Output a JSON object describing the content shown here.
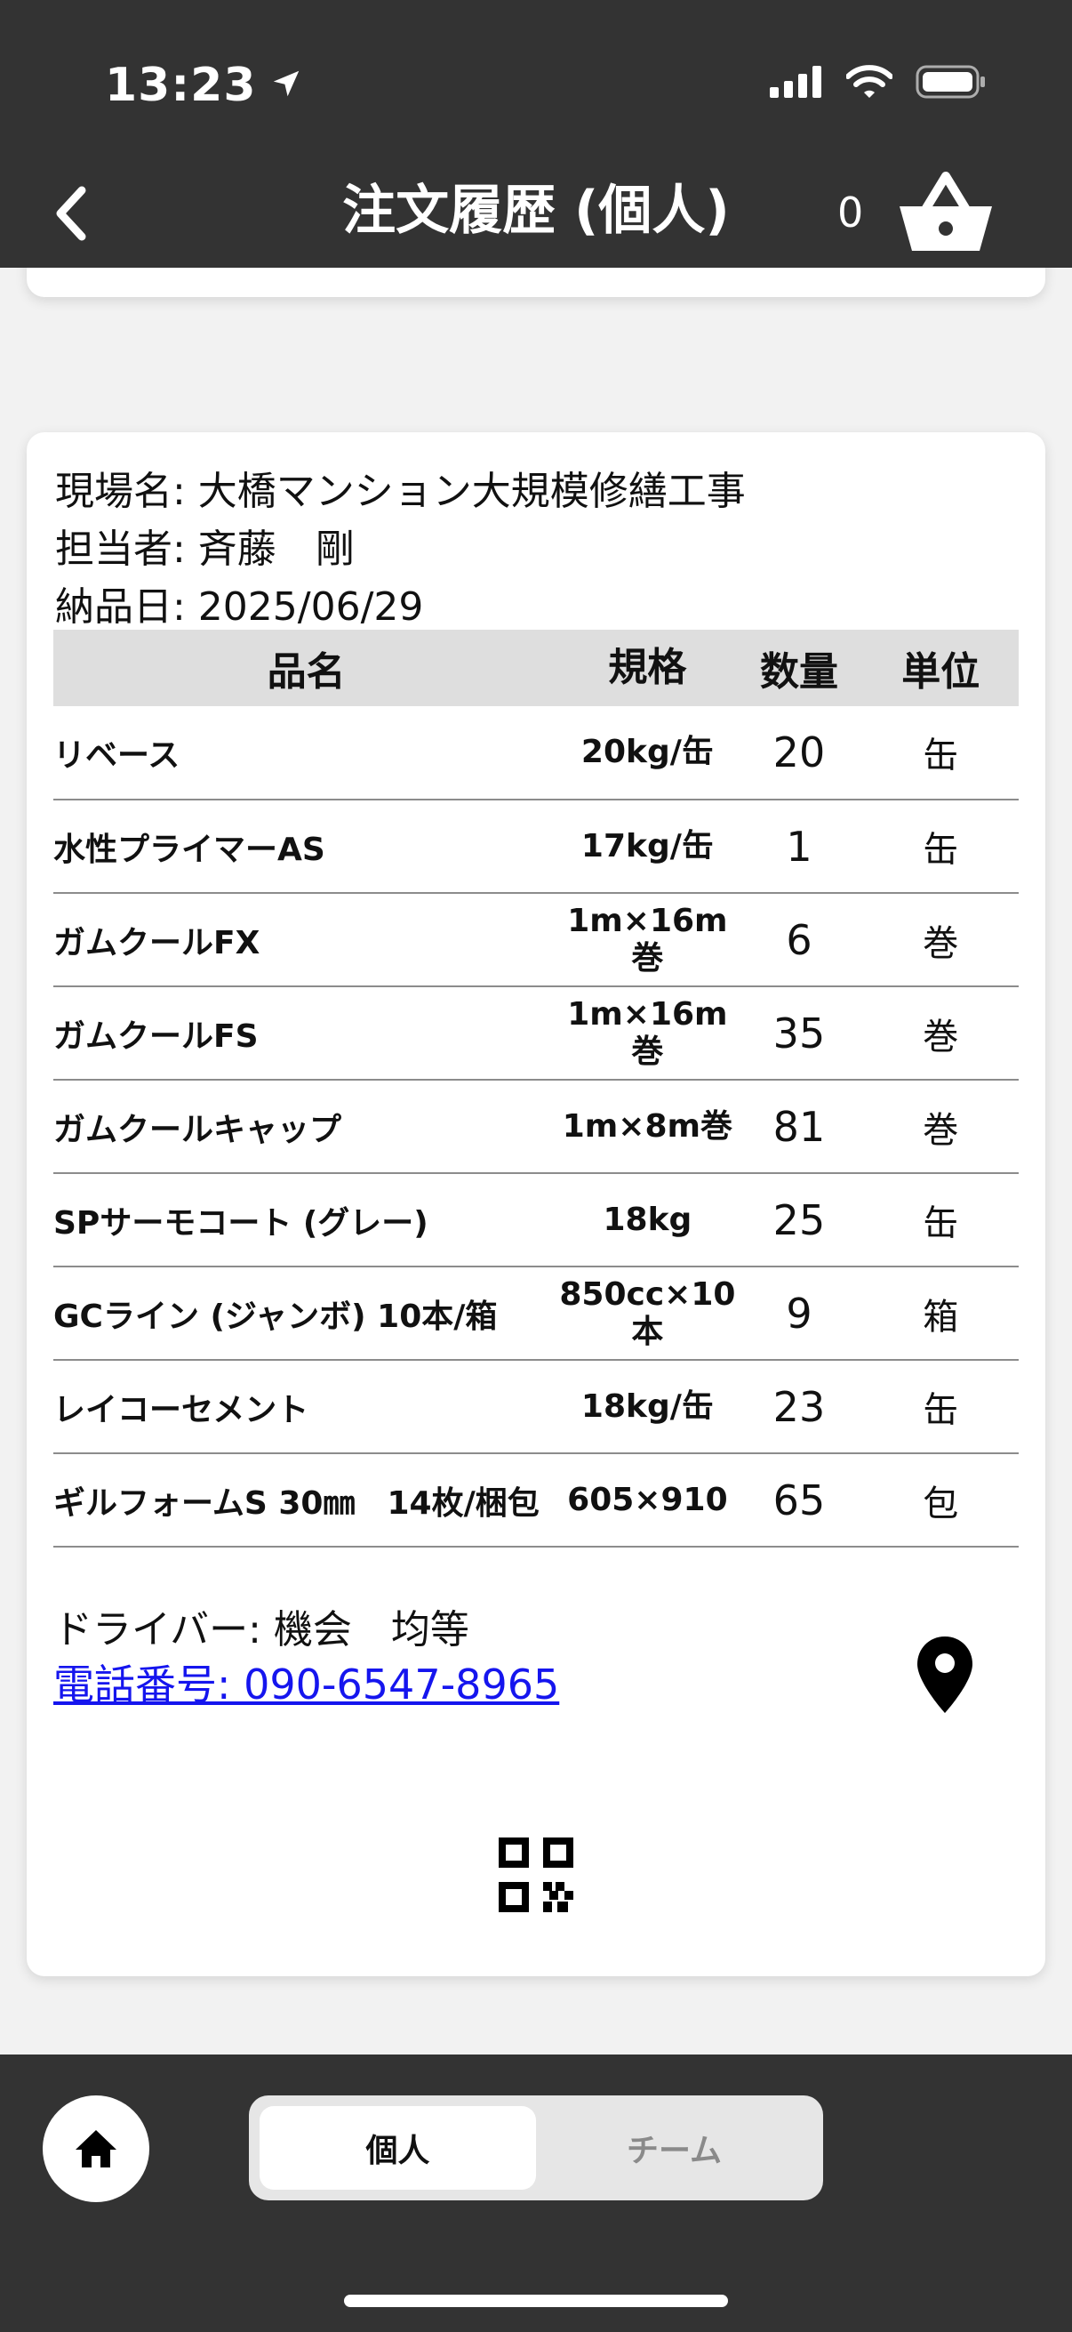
{
  "status_bar": {
    "time": "13:23",
    "icons": [
      "location-arrow-icon",
      "signal-icon",
      "wifi-icon",
      "battery-icon"
    ]
  },
  "nav": {
    "back_icon": "chevron-left-icon",
    "title": "注文履歴 (個人)",
    "cart_count": "0",
    "cart_icon": "basket-icon"
  },
  "order": {
    "site_label": "現場名: 大橋マンション大規模修繕工事",
    "person_label": "担当者: 斉藤　剛",
    "date_label": "納品日: 2025/06/29",
    "columns": {
      "name": "品名",
      "spec": "規格",
      "qty": "数量",
      "unit": "単位"
    },
    "items": [
      {
        "name": "リベース",
        "spec": "20kg/缶",
        "qty": "20",
        "unit": "缶"
      },
      {
        "name": "水性プライマーAS",
        "spec": "17kg/缶",
        "qty": "1",
        "unit": "缶"
      },
      {
        "name": "ガムクールFX",
        "spec": "1m×16m巻",
        "qty": "6",
        "unit": "巻"
      },
      {
        "name": "ガムクールFS",
        "spec": "1m×16m巻",
        "qty": "35",
        "unit": "巻"
      },
      {
        "name": "ガムクールキャップ",
        "spec": "1m×8m巻",
        "qty": "81",
        "unit": "巻"
      },
      {
        "name": "SPサーモコート (グレー)",
        "spec": "18kg",
        "qty": "25",
        "unit": "缶"
      },
      {
        "name": "GCライン (ジャンボ) 10本/箱",
        "spec": "850cc×10本",
        "qty": "9",
        "unit": "箱"
      },
      {
        "name": "レイコーセメント",
        "spec": "18kg/缶",
        "qty": "23",
        "unit": "缶"
      },
      {
        "name": "ギルフォームS 30㎜　14枚/梱包",
        "spec": "605×910",
        "qty": "65",
        "unit": "包"
      }
    ],
    "driver_label": "ドライバー: 機会　均等",
    "phone_label": "電話番号: 090-6547-8965",
    "pin_icon": "map-pin-icon",
    "qr_icon": "qr-code-icon"
  },
  "bottom_bar": {
    "home_icon": "home-icon",
    "tabs": [
      {
        "label": "個人",
        "active": true
      },
      {
        "label": "チーム",
        "active": false
      }
    ]
  },
  "colors": {
    "header_bg": "#333333",
    "link": "#1515ee",
    "table_header_bg": "#dedede"
  }
}
